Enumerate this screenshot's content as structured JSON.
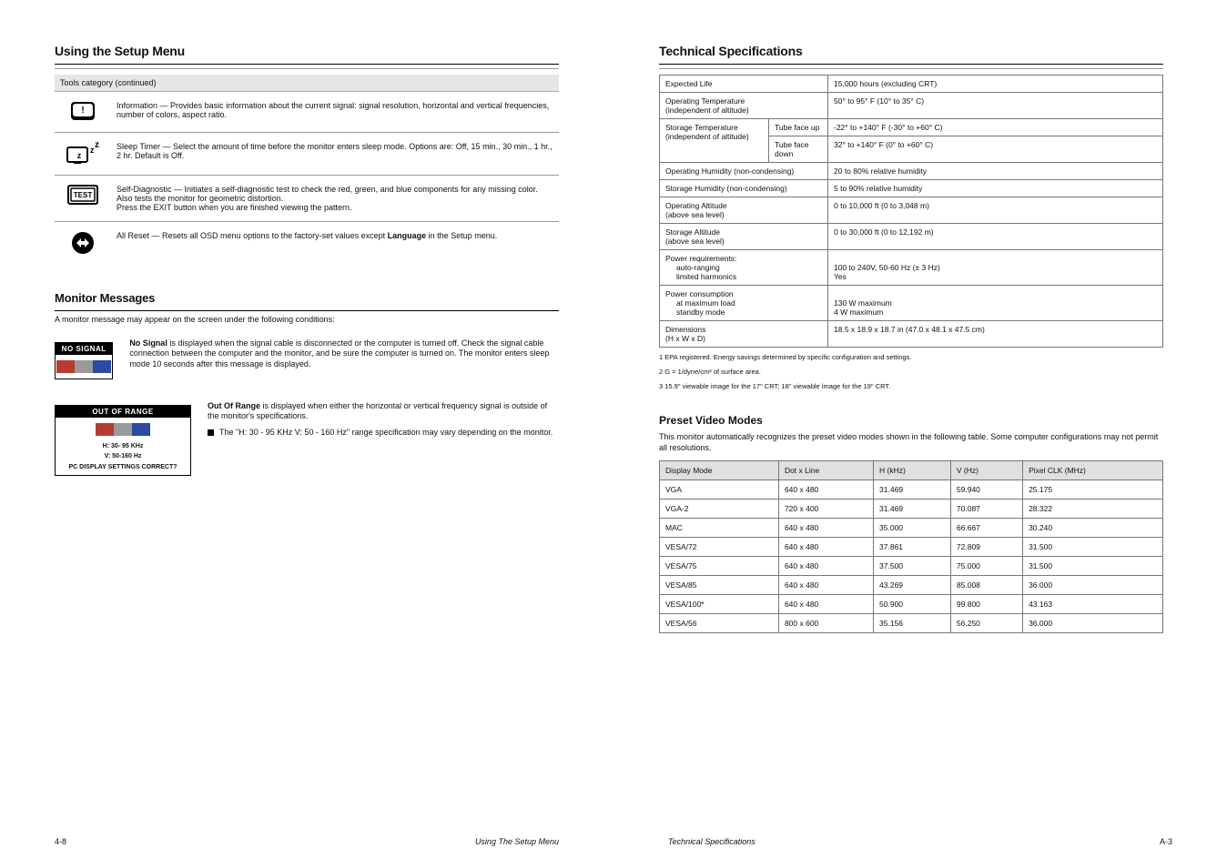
{
  "left": {
    "section_title": "Using the Setup Menu",
    "table_header": "Tools category (continued)",
    "rows": [
      {
        "name": "Information",
        "desc": "Provides basic information about the current signal: signal resolution, horizontal and vertical frequencies, number of colors, aspect ratio."
      },
      {
        "name": "Sleep Timer",
        "desc": "Select the amount of time before the monitor enters sleep mode. Options are: Off, 15 min., 30 min., 1 hr., 2 hr. Default is Off."
      },
      {
        "name": "Self-Diagnostic",
        "desc": "Initiates a self-diagnostic test to check the red, green, and blue components for any missing color. Also tests the monitor for geometric distortion.\nPress the EXIT button when you are finished viewing the pattern."
      },
      {
        "name": "All Reset",
        "desc_prefix": "Resets all OSD menu options to the factory-set values except ",
        "desc_lang": "Language",
        "desc_suffix": " in the Setup menu."
      }
    ],
    "msg_section_title": "Monitor Messages",
    "msg_intro": "A monitor message may appear on the screen under the following conditions:",
    "no_signal": {
      "box_title": "NO SIGNAL",
      "heading": "No Signal",
      "desc": " is displayed when the signal cable is disconnected or the computer is turned off. Check the signal cable connection between the computer and the monitor, and be sure the computer is turned on. The monitor enters sleep mode 10 seconds after this message is displayed."
    },
    "out_of_range": {
      "box_title": "OUT OF RANGE",
      "sub1": "H: 30- 95 KHz",
      "sub2": "V: 50-160 Hz",
      "sub3": "PC DISPLAY SETTINGS CORRECT?",
      "heading": "Out Of Range",
      "desc": " is displayed when either the horizontal or vertical frequency signal is outside of the monitor's specifications.",
      "bullet": "The \"H: 30 - 95 KHz   V: 50 - 160 Hz\" range specification may vary depending on the monitor."
    },
    "footer": {
      "page": "4-8",
      "section": "Using the Setup Menu"
    }
  },
  "right": {
    "section_title": "Technical Specifications",
    "spec_rows": [
      {
        "k": "Expected Life",
        "v": "15,000 hours (excluding CRT)"
      },
      {
        "k": [
          "Operating Temperature",
          "(independent of altitude)"
        ],
        "v": "50° to 95° F (10° to 35° C)"
      },
      {
        "k": [
          "Storage Temperature",
          "(independent of altitude)"
        ],
        "rows": [
          {
            "sub": "Tube face up",
            "v": "-22° to +140° F (-30° to +60° C)"
          },
          {
            "sub": "Tube face down",
            "v": "32° to +140° F (0° to +60° C)"
          }
        ]
      },
      {
        "k": "Operating Humidity (non-condensing)",
        "v": "20 to 80% relative humidity"
      },
      {
        "k": "Storage Humidity (non-condensing)",
        "v": "5 to 90% relative humidity"
      },
      {
        "k": [
          "Operating Altitude",
          "(above sea level)"
        ],
        "v": "0 to 10,000 ft (0 to 3,048 m)"
      },
      {
        "k": [
          "Storage Altitude",
          "(above sea level)"
        ],
        "v": "0 to 30,000 ft (0 to 12,192 m)"
      },
      {
        "kmulti": [
          "Power requirements:",
          "    auto-ranging",
          "    limited harmonics"
        ],
        "v": [
          "",
          "100 to 240V, 50-60 Hz (± 3 Hz)",
          "Yes"
        ]
      },
      {
        "kmulti": [
          "Power consumption",
          "    at maximum load",
          "    standby mode"
        ],
        "v": [
          "",
          "130 W maximum",
          "4 W maximum"
        ]
      },
      {
        "k": [
          "Dimensions",
          " (H x W x D)"
        ],
        "v": "18.5 x 18.9 x 18.7 in (47.0 x 48.1 x 47.5 cm)"
      }
    ],
    "notes": [
      "1 EPA registered. Energy savings determined by specific configuration and settings.",
      "2 G = 1/dyne/cm² of surface area.",
      "3 15.9\" viewable image for the 17\" CRT; 18\" viewable image for the 19\" CRT."
    ],
    "preset_title": "Preset Video Modes",
    "preset_intro": "This monitor automatically recognizes the preset video modes shown in the following table. Some computer configurations may not permit all resolutions.",
    "timing": {
      "headers": [
        "Display Mode",
        "Dot x Line",
        "H (kHz)",
        "V (Hz)",
        "Pixel CLK (MHz)"
      ],
      "rows": [
        [
          "VGA",
          "640 x 480",
          "31.469",
          "59.940",
          "25.175"
        ],
        [
          "VGA-2",
          "720 x 400",
          "31.469",
          "70.087",
          "28.322"
        ],
        [
          "MAC",
          "640 x 480",
          "35.000",
          "66.667",
          "30.240"
        ],
        [
          "VESA/72",
          "640 x 480",
          "37.861",
          "72.809",
          "31.500"
        ],
        [
          "VESA/75",
          "640 x 480",
          "37.500",
          "75.000",
          "31.500"
        ],
        [
          "VESA/85",
          "640 x 480",
          "43.269",
          "85.008",
          "36.000"
        ],
        [
          "VESA/100*",
          "640 x 480",
          "50.900",
          "99.800",
          "43.163"
        ],
        [
          "VESA/56",
          "800 x 600",
          "35.156",
          "56.250",
          "36.000"
        ]
      ]
    },
    "footer": {
      "page": "A-3",
      "section": "Technical Specifications"
    }
  }
}
